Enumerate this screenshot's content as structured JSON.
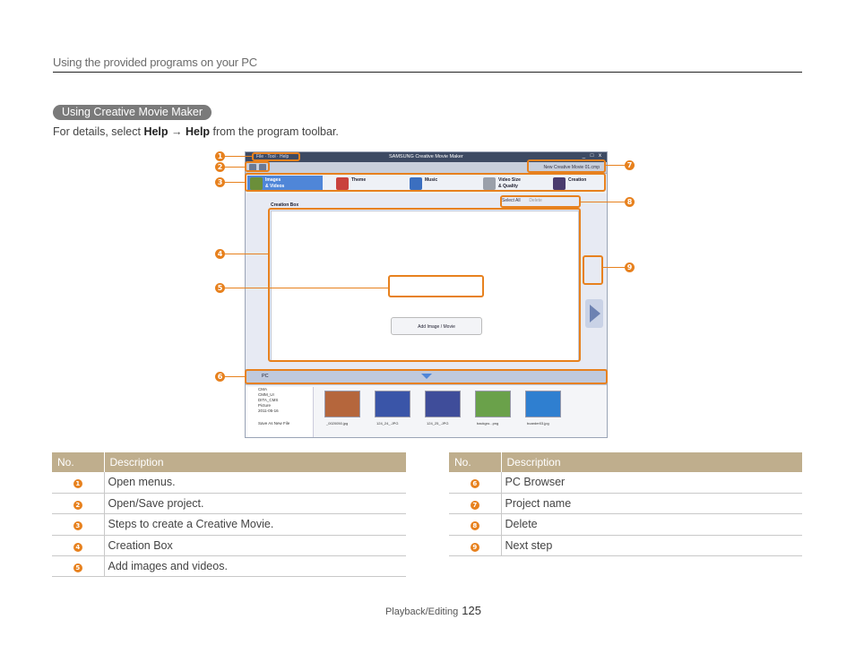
{
  "header": {
    "title": "Using the provided programs on your PC"
  },
  "section": {
    "badge": "Using Creative Movie Maker",
    "intro_pre": "For details, select ",
    "intro_help1": "Help",
    "intro_arrow": " → ",
    "intro_help2": "Help",
    "intro_post": " from the program toolbar."
  },
  "screenshot": {
    "menus": "File · Tool · Help",
    "app_title": "SAMSUNG Creative Movie Maker",
    "window_buttons": "_ □ x",
    "project_name": "New Creative Movie 01.cmp",
    "steps": [
      {
        "line1": "Images",
        "line2": "& Videos",
        "icon": "images-videos-icon",
        "color": "#6b8f3a"
      },
      {
        "line1": "Theme",
        "line2": "",
        "icon": "theme-icon",
        "color": "#c9423d"
      },
      {
        "line1": "Music",
        "line2": "",
        "icon": "music-icon",
        "color": "#3b6fc0"
      },
      {
        "line1": "Video Size",
        "line2": "& Quality",
        "icon": "video-size-icon",
        "color": "#9aa0aa"
      },
      {
        "line1": "Creation",
        "line2": "",
        "icon": "creation-icon",
        "color": "#4a3c6e"
      }
    ],
    "creation_box_label": "Creation Box",
    "select_all": "Select All",
    "delete": "Delete",
    "add_button": "Add Image / Movie",
    "pc_label": "PC",
    "tree_items": [
      "CMA",
      "CMM_UI",
      "DITA_CMS",
      "Picture",
      "2011-05-16"
    ],
    "save_new_file": "Save As New File",
    "thumbnails": [
      {
        "name": "_0020050.jpg",
        "color": "#b5663c"
      },
      {
        "name": "124_24_.JPG",
        "color": "#3a55a8"
      },
      {
        "name": "124_25_.JPG",
        "color": "#3f4d9a"
      },
      {
        "name": "backgro...png",
        "color": "#6aa14a"
      },
      {
        "name": "boarder03.jpg",
        "color": "#2f7fd0"
      }
    ]
  },
  "callouts": [
    "1",
    "2",
    "3",
    "4",
    "5",
    "6",
    "7",
    "8",
    "9"
  ],
  "table_left": {
    "headers": [
      "No.",
      "Description"
    ],
    "rows": [
      {
        "no": "1",
        "desc": "Open menus."
      },
      {
        "no": "2",
        "desc": "Open/Save project."
      },
      {
        "no": "3",
        "desc": "Steps to create a Creative Movie."
      },
      {
        "no": "4",
        "desc": "Creation Box"
      },
      {
        "no": "5",
        "desc": "Add images and videos."
      }
    ]
  },
  "table_right": {
    "headers": [
      "No.",
      "Description"
    ],
    "rows": [
      {
        "no": "6",
        "desc": "PC Browser"
      },
      {
        "no": "7",
        "desc": "Project name"
      },
      {
        "no": "8",
        "desc": "Delete"
      },
      {
        "no": "9",
        "desc": "Next step"
      }
    ]
  },
  "footer": {
    "section": "Playback/Editing",
    "page": "125"
  },
  "colors": {
    "accent": "#e7811e",
    "table_header": "#bfae8d",
    "badge": "#7a7a7a"
  }
}
